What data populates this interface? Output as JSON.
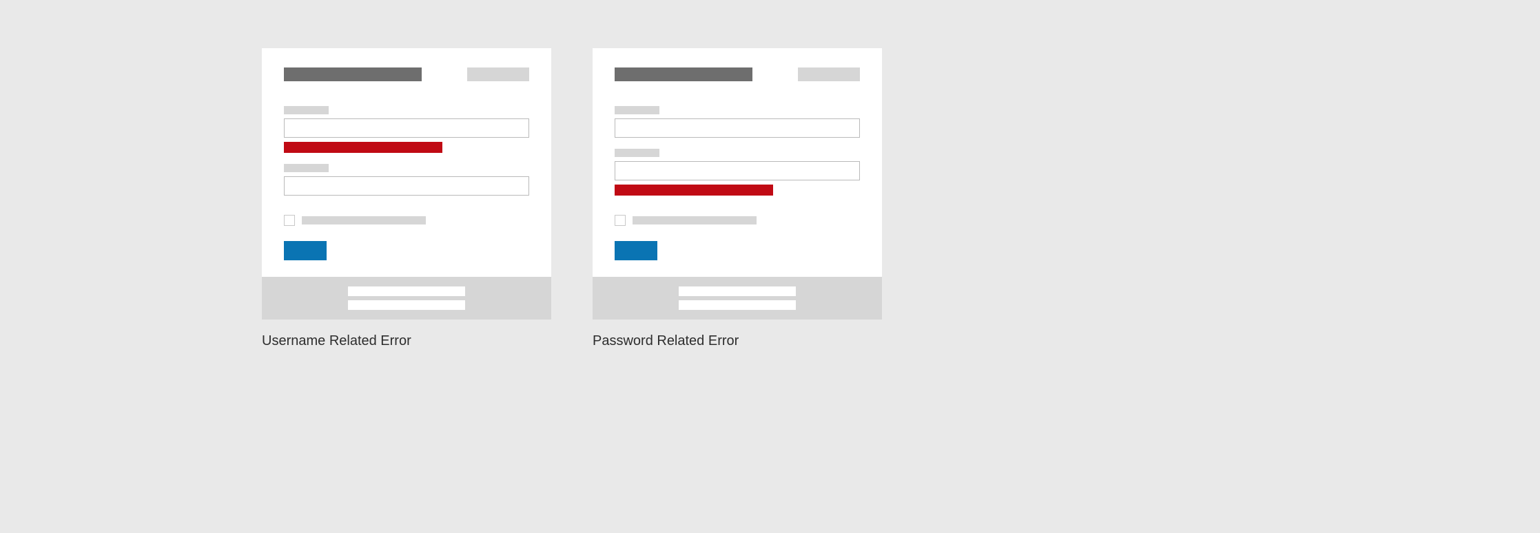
{
  "examples": [
    {
      "caption": "Username Related Error",
      "errorOn": "username"
    },
    {
      "caption": "Password Related Error",
      "errorOn": "password"
    }
  ],
  "colors": {
    "background": "#e9e9e9",
    "card": "#ffffff",
    "title_block": "#6e6e6e",
    "placeholder": "#d6d6d6",
    "input_border": "#b9b9b9",
    "error": "#c00a14",
    "button": "#0a74b3",
    "footer": "#d6d6d6",
    "caption_text": "#2d2d2d"
  }
}
